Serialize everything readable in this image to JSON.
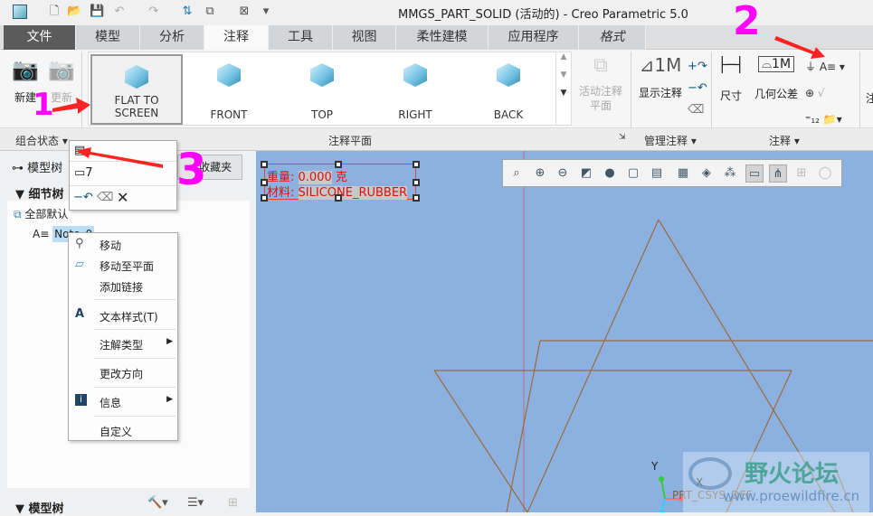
{
  "window": {
    "title": "MMGS_PART_SOLID (活动的) - Creo Parametric 5.0"
  },
  "tabs": [
    {
      "label": "文件"
    },
    {
      "label": "模型"
    },
    {
      "label": "分析"
    },
    {
      "label": "注释"
    },
    {
      "label": "工具"
    },
    {
      "label": "视图"
    },
    {
      "label": "柔性建模"
    },
    {
      "label": "应用程序"
    },
    {
      "label": "格式"
    }
  ],
  "ribbon": {
    "combo": {
      "new": "新建",
      "update": "更新",
      "group": "组合状态"
    },
    "planes": {
      "items": [
        "FLAT TO SCREEN",
        "FRONT",
        "TOP",
        "RIGHT",
        "BACK"
      ],
      "active_plane": "活动注释平面",
      "group": "注释平面"
    },
    "manage": {
      "show": "显示注释",
      "group": "管理注释"
    },
    "annotate": {
      "dim": "尺寸",
      "gtol": "几何公差",
      "group": "注释"
    },
    "cut": "注"
  },
  "annotations": {
    "one": "1",
    "two": "2",
    "three": "3"
  },
  "leftpanel": {
    "model_tree": "模型树",
    "favorites": "收藏夹",
    "detail_tree": "细节树",
    "all_default": "全部默认",
    "note_item": "Note_0",
    "bottom_model_tree": "模型树"
  },
  "context_menu": {
    "items": [
      "移动",
      "移动至平面",
      "添加链接",
      "文本样式(T)",
      "注解类型",
      "更改方向",
      "信息",
      "自定义"
    ]
  },
  "note": {
    "weight_label": "重量:",
    "weight_value": "0.000",
    "weight_unit": "克",
    "material_label": "材料:",
    "material_value": "SILICONE_RUBBER"
  },
  "viewport": {
    "csys": "PRT_CSYS_DEF",
    "axis_x": "X",
    "axis_y": "Y"
  },
  "watermark": {
    "name": "野火论坛",
    "url": "www.proewildfire.cn"
  },
  "colors": {
    "viewport": "#8cb1e0",
    "note": "#dd1111",
    "geometry": "#9b6a3c",
    "annotation": "#ff00ff"
  }
}
